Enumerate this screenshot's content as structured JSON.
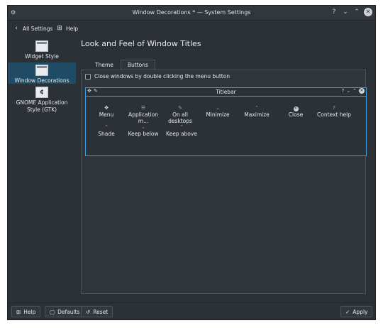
{
  "window": {
    "title": "Window Decorations * — System Settings",
    "controls": [
      "?",
      "⌄",
      "⌃",
      "✕"
    ]
  },
  "toolbar": {
    "back_label": "All Settings",
    "help_label": "Help"
  },
  "sidebar": {
    "items": [
      {
        "label": "Widget Style",
        "active": false
      },
      {
        "label": "Window Decorations",
        "active": true
      },
      {
        "label": "GNOME Application Style (GTK)",
        "active": false
      }
    ]
  },
  "main": {
    "title": "Look and Feel of Window Titles",
    "tabs": [
      {
        "label": "Theme",
        "active": false
      },
      {
        "label": "Buttons",
        "active": true
      }
    ],
    "close_dblclick_label": "Close windows by double clicking the menu button",
    "close_dblclick_checked": false,
    "preview_title": "Titlebar",
    "available_buttons": [
      {
        "label": "Menu",
        "icon": "menu-icon"
      },
      {
        "label": "Application m...",
        "icon": "app-menu-icon"
      },
      {
        "label": "On all desktops",
        "icon": "pin-icon"
      },
      {
        "label": "Minimize",
        "icon": "minimize-icon"
      },
      {
        "label": "Maximize",
        "icon": "maximize-icon"
      },
      {
        "label": "Close",
        "icon": "close-icon"
      },
      {
        "label": "Context help",
        "icon": "help-icon"
      },
      {
        "label": "Shade",
        "icon": "shade-icon"
      },
      {
        "label": "Keep below",
        "icon": "keep-below-icon"
      },
      {
        "label": "Keep above",
        "icon": "keep-above-icon"
      }
    ]
  },
  "footer": {
    "help_label": "Help",
    "defaults_label": "Defaults",
    "reset_label": "Reset",
    "apply_label": "Apply"
  },
  "colors": {
    "window_bg": "#2b3136",
    "selection": "#1f4b64",
    "accent": "#3d9ee0"
  }
}
